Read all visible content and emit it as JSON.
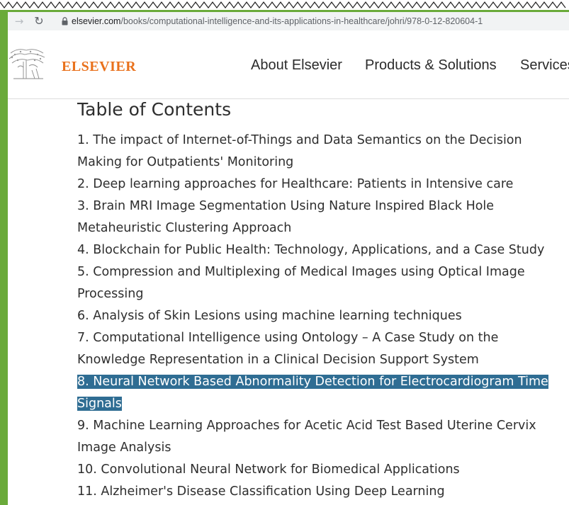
{
  "browser": {
    "url_host": "elsevier.com",
    "url_path": "/books/computational-intelligence-and-its-applications-in-healthcare/johri/978-0-12-820604-1"
  },
  "header": {
    "brand": "ELSEVIER",
    "nav": [
      "About Elsevier",
      "Products & Solutions",
      "Services"
    ]
  },
  "main": {
    "title": "Table of Contents",
    "chapters": [
      {
        "lines": [
          "1. The impact of Internet-of-Things and Data Semantics on the Decision",
          "Making for Outpatients' Monitoring"
        ],
        "selected": false
      },
      {
        "lines": [
          "2. Deep learning approaches for Healthcare: Patients in Intensive care"
        ],
        "selected": false
      },
      {
        "lines": [
          "3. Brain MRI Image Segmentation Using Nature Inspired Black Hole",
          "Metaheuristic Clustering Approach"
        ],
        "selected": false
      },
      {
        "lines": [
          "4. Blockchain for Public Health: Technology, Applications, and a Case Study"
        ],
        "selected": false
      },
      {
        "lines": [
          "5. Compression and Multiplexing of Medical Images using Optical Image",
          "Processing"
        ],
        "selected": false
      },
      {
        "lines": [
          "6. Analysis of Skin Lesions using machine learning techniques"
        ],
        "selected": false
      },
      {
        "lines": [
          "7. Computational Intelligence using Ontology – A Case Study on the",
          "Knowledge Representation in a Clinical Decision Support System"
        ],
        "selected": false
      },
      {
        "lines": [
          "8. Neural Network Based Abnormality Detection for Electrocardiogram Time",
          "Signals"
        ],
        "selected": true
      },
      {
        "lines": [
          "9. Machine Learning Approaches for Acetic Acid Test Based Uterine Cervix",
          "Image Analysis"
        ],
        "selected": false
      },
      {
        "lines": [
          "10. Convolutional Neural Network for Biomedical Applications"
        ],
        "selected": false
      },
      {
        "lines": [
          "11. Alzheimer's Disease Classification Using Deep Learning"
        ],
        "selected": false
      }
    ]
  },
  "colors": {
    "frame_green": "#6aaa3a",
    "brand_orange": "#e9711c",
    "selection_blue": "#2f6d93"
  }
}
